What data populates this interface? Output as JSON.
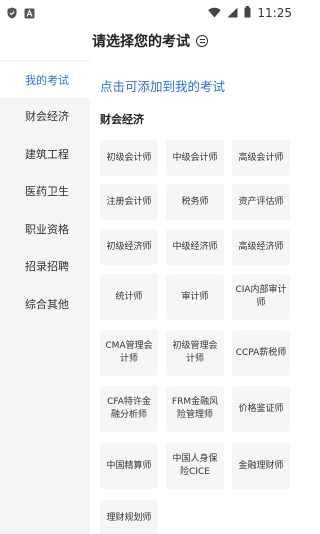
{
  "status_bar": {
    "time": "11:25"
  },
  "header": {
    "title": "请选择您的考试"
  },
  "sidebar": {
    "items": [
      {
        "label": "我的考试"
      },
      {
        "label": "财会经济"
      },
      {
        "label": "建筑工程"
      },
      {
        "label": "医药卫生"
      },
      {
        "label": "职业资格"
      },
      {
        "label": "招录招聘"
      },
      {
        "label": "综合其他"
      }
    ]
  },
  "main": {
    "add_link": "点击可添加到我的考试",
    "section_title": "财会经济",
    "exams": [
      {
        "label": "初级会计师"
      },
      {
        "label": "中级会计师"
      },
      {
        "label": "高级会计师"
      },
      {
        "label": "注册会计师"
      },
      {
        "label": "税务师"
      },
      {
        "label": "资产评估师"
      },
      {
        "label": "初级经济师"
      },
      {
        "label": "中级经济师"
      },
      {
        "label": "高级经济师"
      },
      {
        "label": "统计师"
      },
      {
        "label": "审计师"
      },
      {
        "label": "CIA内部审计师"
      },
      {
        "label": "CMA管理会计师"
      },
      {
        "label": "初级管理会计师"
      },
      {
        "label": "CCPA薪税师"
      },
      {
        "label": "CFA特许金融分析师"
      },
      {
        "label": "FRM金融风险管理师"
      },
      {
        "label": "价格鉴证师"
      },
      {
        "label": "中国精算师"
      },
      {
        "label": "中国人身保险CICE"
      },
      {
        "label": "金融理财师"
      },
      {
        "label": "理财规划师"
      }
    ]
  }
}
